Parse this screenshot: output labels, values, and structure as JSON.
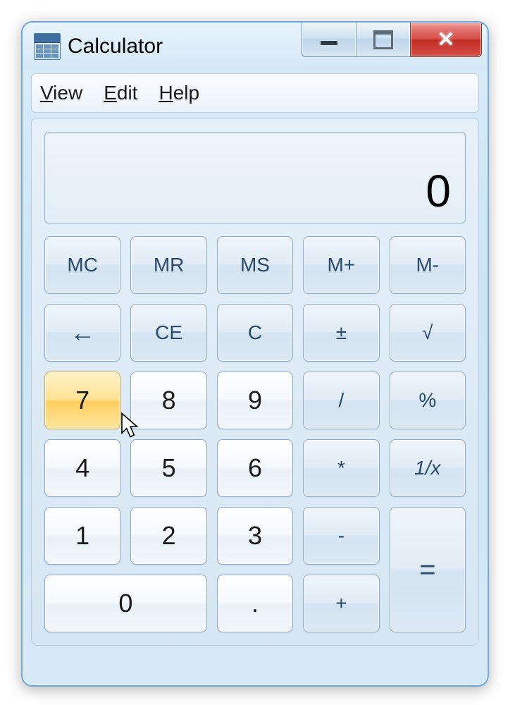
{
  "window": {
    "title": "Calculator"
  },
  "menu": {
    "view": "View",
    "edit": "Edit",
    "help": "Help"
  },
  "display": {
    "value": "0"
  },
  "buttons": {
    "mc": "MC",
    "mr": "MR",
    "ms": "MS",
    "mplus": "M+",
    "mminus": "M-",
    "back": "←",
    "ce": "CE",
    "c": "C",
    "negate": "±",
    "sqrt": "√",
    "d7": "7",
    "d8": "8",
    "d9": "9",
    "div": "/",
    "percent": "%",
    "d4": "4",
    "d5": "5",
    "d6": "6",
    "mul": "*",
    "recip": "1/x",
    "d1": "1",
    "d2": "2",
    "d3": "3",
    "sub": "-",
    "eq": "=",
    "d0": "0",
    "dot": ".",
    "add": "+"
  }
}
